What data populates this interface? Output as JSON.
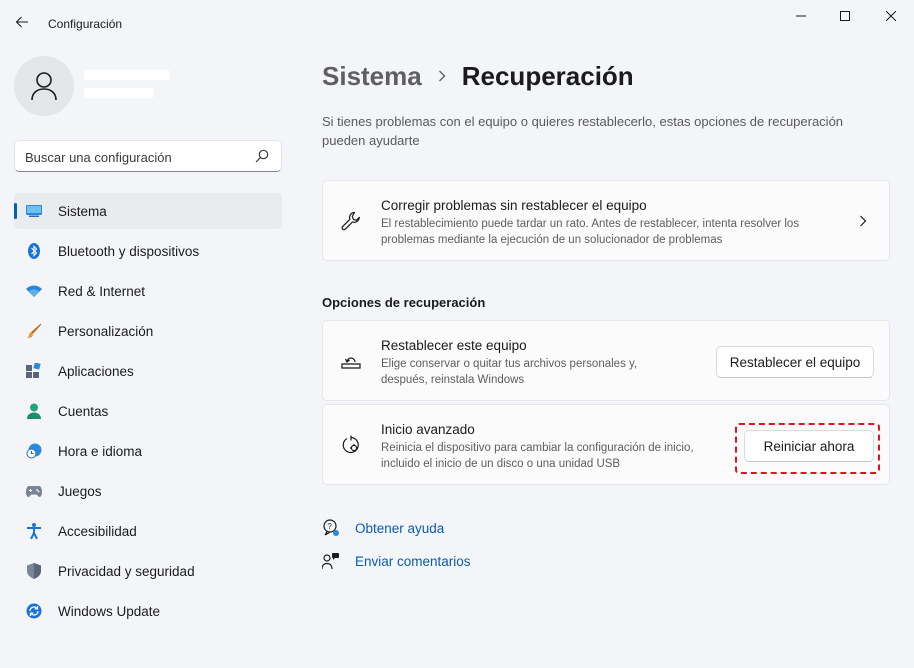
{
  "window": {
    "title": "Configuración"
  },
  "profile": {
    "name": "",
    "email": ""
  },
  "search": {
    "placeholder": "Buscar una configuración"
  },
  "sidebar": {
    "items": [
      {
        "label": "Sistema",
        "icon": "system-icon",
        "active": true
      },
      {
        "label": "Bluetooth y dispositivos",
        "icon": "bluetooth-icon"
      },
      {
        "label": "Red & Internet",
        "icon": "wifi-icon"
      },
      {
        "label": "Personalización",
        "icon": "brush-icon"
      },
      {
        "label": "Aplicaciones",
        "icon": "apps-icon"
      },
      {
        "label": "Cuentas",
        "icon": "account-icon"
      },
      {
        "label": "Hora e idioma",
        "icon": "clock-globe-icon"
      },
      {
        "label": "Juegos",
        "icon": "gamepad-icon"
      },
      {
        "label": "Accesibilidad",
        "icon": "accessibility-icon"
      },
      {
        "label": "Privacidad y seguridad",
        "icon": "shield-icon"
      },
      {
        "label": "Windows Update",
        "icon": "windows-update-icon"
      }
    ]
  },
  "breadcrumb": {
    "parent": "Sistema",
    "current": "Recuperación"
  },
  "main": {
    "description": "Si tienes problemas con el equipo o quieres restablecerlo, estas opciones de recuperación pueden ayudarte",
    "troubleshoot_card": {
      "title": "Corregir problemas sin restablecer el equipo",
      "subtitle": "El restablecimiento puede tardar un rato. Antes de restablecer, intenta resolver los problemas mediante la ejecución de un solucionador de problemas"
    },
    "section_title": "Opciones de recuperación",
    "reset_card": {
      "title": "Restablecer este equipo",
      "subtitle": "Elige conservar o quitar tus archivos personales y, después, reinstala Windows",
      "button": "Restablecer el equipo"
    },
    "advanced_card": {
      "title": "Inicio avanzado",
      "subtitle": "Reinicia el dispositivo para cambiar la configuración de inicio, incluido el inicio de un disco o una unidad USB",
      "button": "Reiniciar ahora"
    },
    "links": {
      "help": "Obtener ayuda",
      "feedback": "Enviar comentarios"
    }
  },
  "colors": {
    "accent": "#005fb8",
    "highlight": "#e0141e",
    "link": "#0b5cad"
  }
}
